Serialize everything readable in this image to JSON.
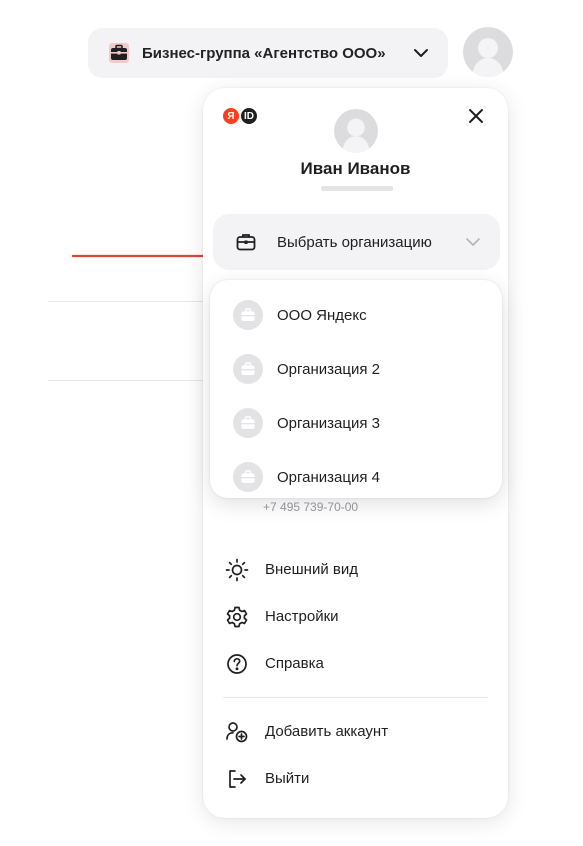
{
  "header": {
    "organization_label": "Бизнес-группа «Агентство ООО»",
    "icons": [
      "briefcase-icon",
      "chevron-down-icon",
      "user-avatar"
    ]
  },
  "panel": {
    "logo": {
      "ya": "Я",
      "id": "ID"
    },
    "user": {
      "name": "Иван Иванов"
    },
    "select_org_label": "Выбрать организацию",
    "organizations": [
      {
        "name": "ООО Яндекс"
      },
      {
        "name": "Организация 2"
      },
      {
        "name": "Организация 3"
      },
      {
        "name": "Организация 4"
      }
    ],
    "phone": "+7 495 739-70-00",
    "menu": [
      {
        "label": "Внешний вид",
        "icon": "sun-icon"
      },
      {
        "label": "Настройки",
        "icon": "gear-icon"
      },
      {
        "label": "Справка",
        "icon": "help-icon"
      }
    ],
    "account_menu": [
      {
        "label": "Добавить аккаунт",
        "icon": "add-account-icon"
      },
      {
        "label": "Выйти",
        "icon": "logout-icon"
      }
    ]
  },
  "colors": {
    "accent_red": "#fc3f1d",
    "arrow": "#d9473a",
    "pill_bg": "#f3f3f6",
    "text": "#1f1f21"
  }
}
